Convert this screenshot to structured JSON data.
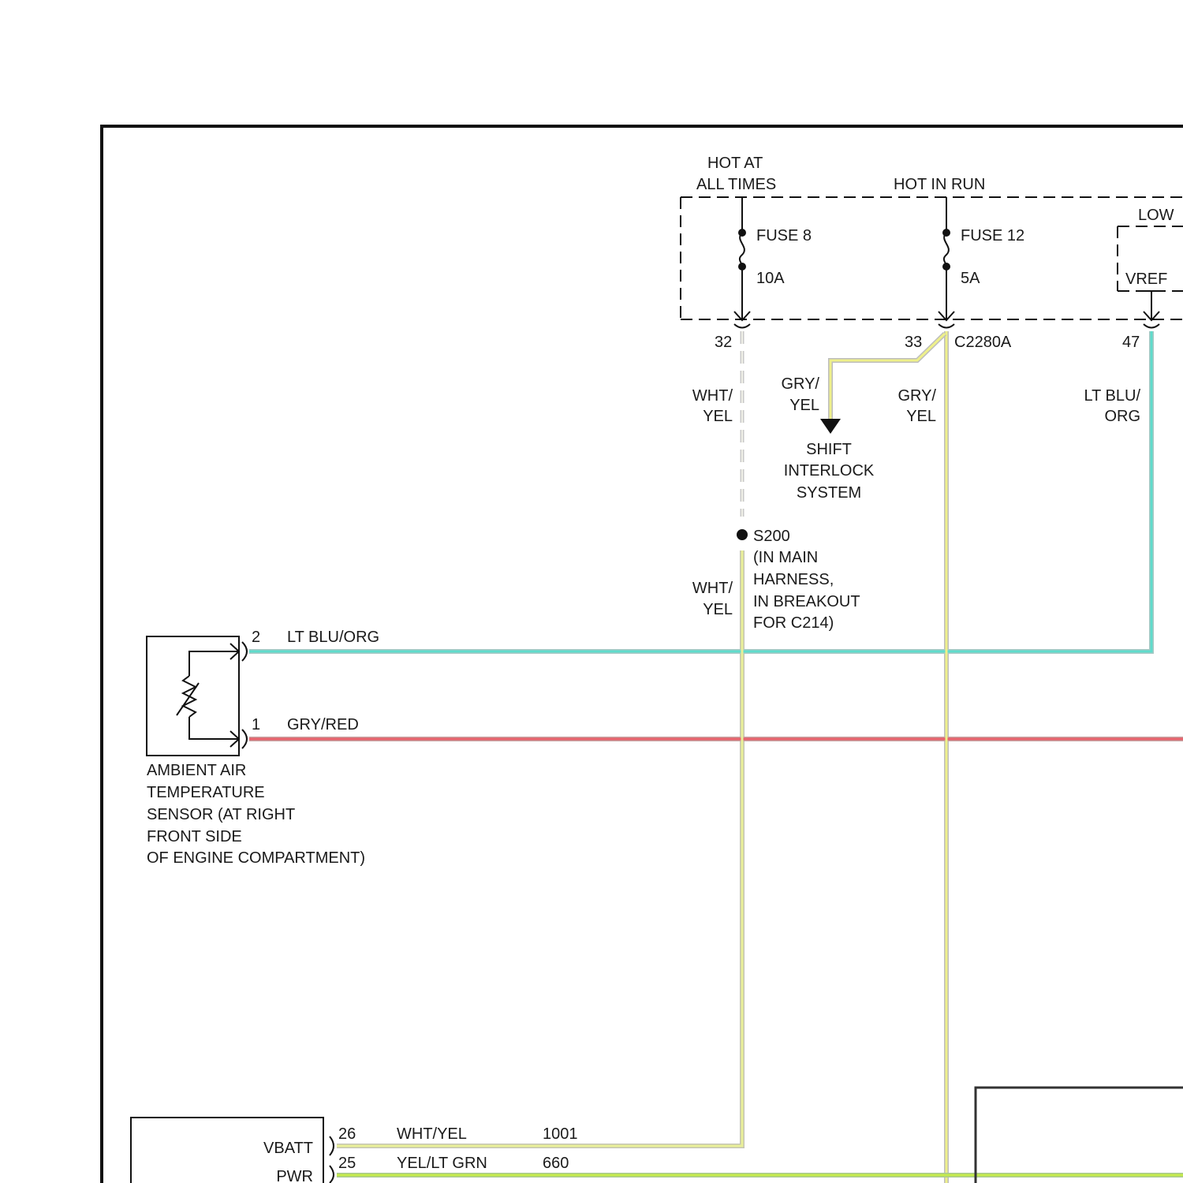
{
  "colors": {
    "frame": "#111111",
    "wht_yel": "#e6ee96",
    "gry_yel": "#eef08a",
    "lt_blu_org": "#5fd6c8",
    "gry_red": "#e0656b",
    "yel_lt_grn": "#c4ea4a",
    "wire_edge": "#b8b8b8"
  },
  "fuse_box": {
    "hot_at_all_times": [
      "HOT AT",
      "ALL TIMES"
    ],
    "hot_in_run": "HOT IN RUN",
    "low": "LOW",
    "vref": "VREF",
    "fuse8": {
      "name": "FUSE 8",
      "rating": "10A"
    },
    "fuse12": {
      "name": "FUSE 12",
      "rating": "5A"
    },
    "connector": "C2280A",
    "pins": {
      "p32": "32",
      "p33": "33",
      "p47": "47"
    }
  },
  "wires": {
    "wht_yel_upper": [
      "WHT/",
      "YEL"
    ],
    "gry_yel_branch": [
      "GRY/",
      "YEL"
    ],
    "gry_yel_main": [
      "GRY/",
      "YEL"
    ],
    "lt_blu_org_vertical": [
      "LT BLU/",
      "ORG"
    ],
    "wht_yel_lower": [
      "WHT/",
      "YEL"
    ]
  },
  "shift_interlock": [
    "SHIFT",
    "INTERLOCK",
    "SYSTEM"
  ],
  "splice": {
    "id": "S200",
    "note": [
      "(IN MAIN",
      "HARNESS,",
      "IN BREAKOUT",
      "FOR C214)"
    ]
  },
  "sensor": {
    "pin2": "2",
    "pin2_color": "LT BLU/ORG",
    "pin1": "1",
    "pin1_color": "GRY/RED",
    "label": [
      "AMBIENT AIR",
      "TEMPERATURE",
      "SENSOR (AT RIGHT",
      "FRONT SIDE",
      "OF ENGINE COMPARTMENT)"
    ]
  },
  "module": {
    "vbatt": "VBATT",
    "pwr": "PWR",
    "pin26": "26",
    "pin26_color": "WHT/YEL",
    "pin26_circuit": "1001",
    "pin25": "25",
    "pin25_color": "YEL/LT GRN",
    "pin25_circuit": "660"
  }
}
